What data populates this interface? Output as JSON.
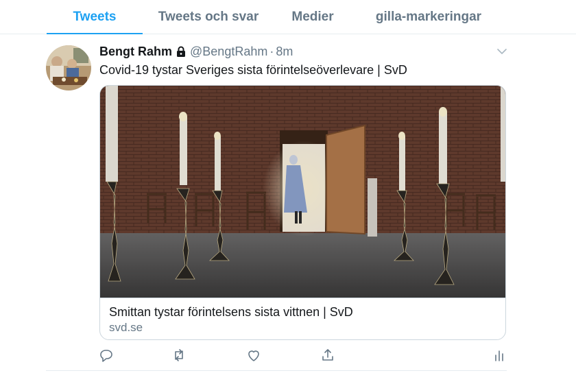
{
  "tabs": [
    {
      "label": "Tweets",
      "active": true
    },
    {
      "label": "Tweets och svar",
      "active": false
    },
    {
      "label": "Medier",
      "active": false
    },
    {
      "label": "gilla-markeringar",
      "active": false
    }
  ],
  "tweet": {
    "author_name": "Bengt Rahm",
    "handle": "@BengtRahm",
    "separator": "·",
    "time": "8m",
    "text": "Covid-19 tystar Sveriges sista förintelseöverlevare | SvD",
    "card": {
      "title": "Smittan tystar förintelsens sista vittnen | SvD",
      "domain": "svd.se"
    }
  },
  "icons": {
    "lock": "lock-icon",
    "caret": "chevron-down-icon",
    "reply": "reply-icon",
    "retweet": "retweet-icon",
    "like": "heart-icon",
    "share": "share-icon",
    "analytics": "analytics-icon"
  },
  "colors": {
    "accent": "#1da1f2",
    "secondary_text": "#657786",
    "primary_text": "#14171a",
    "border": "#e6ecf0"
  }
}
